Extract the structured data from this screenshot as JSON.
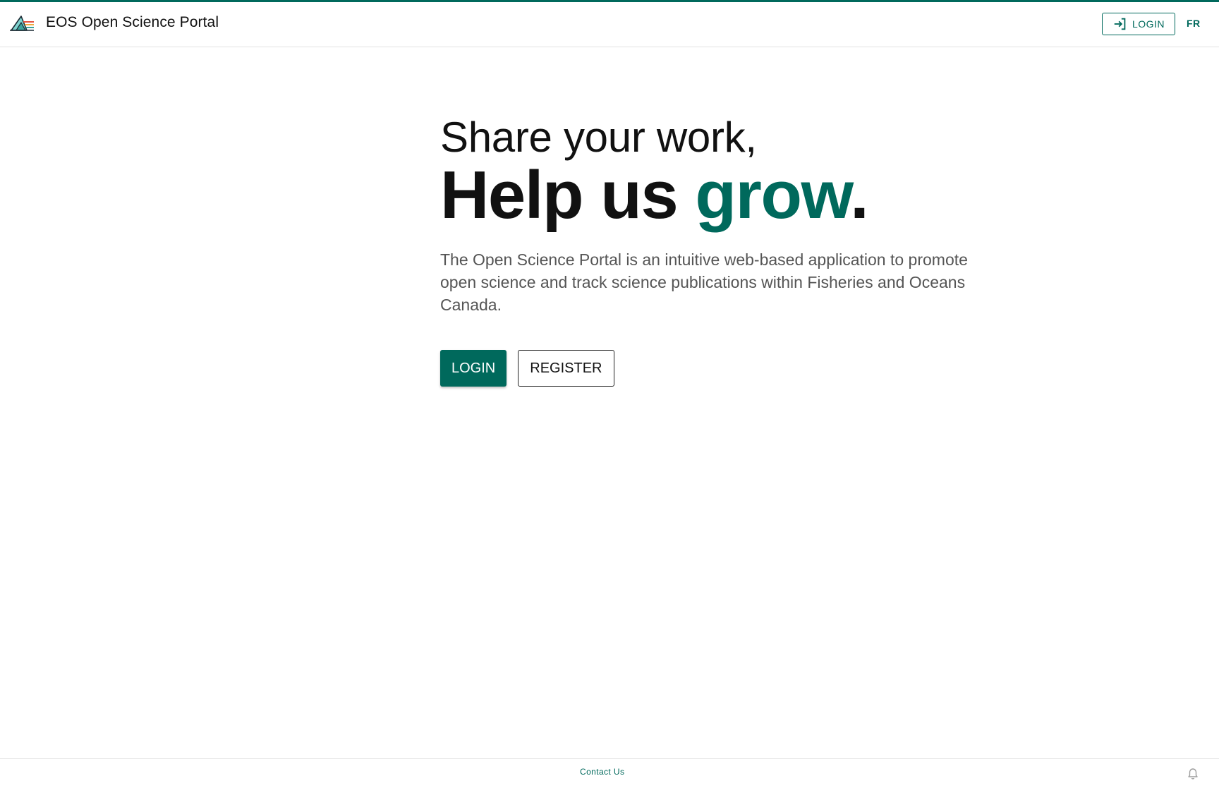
{
  "header": {
    "title": "EOS Open Science Portal",
    "login_label": "LOGIN",
    "language_toggle": "FR",
    "logo_icon": "eos-portal-logo-icon",
    "login_icon": "login-arrow-icon"
  },
  "hero": {
    "headline_line1": "Share your work,",
    "headline_line2_prefix": "Help us ",
    "headline_line2_accent": "grow",
    "headline_line2_suffix": ".",
    "description": "The Open Science Portal is an intuitive web-based application to promote open science and track science publications within Fisheries and Oceans Canada.",
    "login_button": "LOGIN",
    "register_button": "REGISTER"
  },
  "footer": {
    "contact_label": "Contact Us",
    "notification_icon": "bell-icon"
  },
  "colors": {
    "accent": "#00695c",
    "text": "#111111",
    "muted_text": "#555555",
    "divider": "#e3e3e3"
  }
}
